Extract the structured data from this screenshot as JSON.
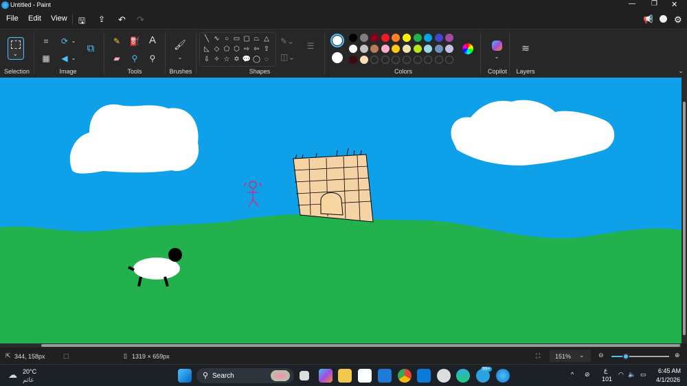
{
  "window": {
    "title": "Untitled - Paint"
  },
  "menu": {
    "file": "File",
    "edit": "Edit",
    "view": "View"
  },
  "ribbon": {
    "groups": {
      "selection": "Selection",
      "image": "Image",
      "tools": "Tools",
      "brushes": "Brushes",
      "shapes": "Shapes",
      "colors": "Colors",
      "copilot": "Copilot",
      "layers": "Layers"
    },
    "shapes": [
      "╲",
      "∿",
      "○",
      "▭",
      "▢",
      "⏢",
      "△",
      "◺",
      "◇",
      "⬠",
      "⬡",
      "⇨",
      "⇦",
      "⇧",
      "⇩",
      "✧",
      "☆",
      "✡",
      "💬",
      "◯",
      "◌",
      "♡",
      "⌂"
    ],
    "colors": {
      "primary": "#ffffff",
      "secondary": "#ffffff",
      "palette": [
        "#000000",
        "#7f7f7f",
        "#880015",
        "#ed1c24",
        "#ff7f27",
        "#fff200",
        "#22b14c",
        "#00a2e8",
        "#3f48cc",
        "#a349a4",
        "#ffffff",
        "#c3c3c3",
        "#b97a57",
        "#ffaec9",
        "#ffc90e",
        "#efe4b0",
        "#b5e61d",
        "#99d9ea",
        "#7092be",
        "#c8bfe7",
        "#3b0a10",
        "#ffdeb4"
      ],
      "empty_slots": 8
    }
  },
  "canvas": {
    "sky": "#0ea0e8",
    "grass": "#22b14c"
  },
  "status": {
    "cursor": "344, 158px",
    "size": "1319 × 659px",
    "zoom": "151%",
    "zoom_level_fraction": 0.25
  },
  "taskbar": {
    "weather_temp": "20°C",
    "weather_desc": "غائم",
    "search": "Search",
    "lang_top": "ع",
    "lang_bottom": "101",
    "time": "6:45 AM",
    "date": "4/1/2026",
    "badge": "99+"
  }
}
